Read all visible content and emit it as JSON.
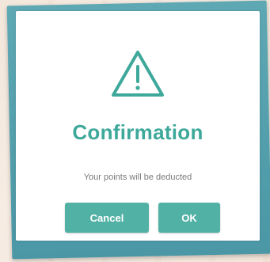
{
  "dialog": {
    "title": "Confirmation",
    "message": "Your points will be deducted",
    "icon": "warning-triangle-icon",
    "cancel_label": "Cancel",
    "ok_label": "OK"
  },
  "colors": {
    "accent": "#3ea89a",
    "button": "#52b1a5",
    "frame": "#5ea8b4"
  }
}
